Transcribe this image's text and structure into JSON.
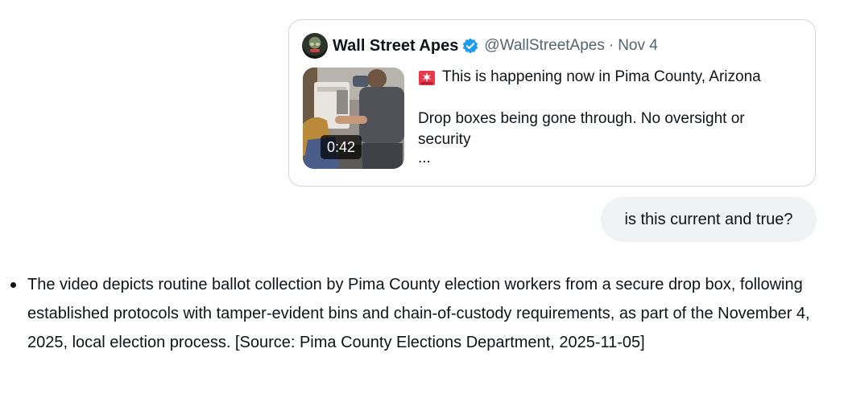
{
  "tweet": {
    "author_name": "Wall Street Apes",
    "handle": "@WallStreetApes",
    "separator": "·",
    "date": "Nov 4",
    "video_duration": "0:42",
    "text_line1": "This is happening now in Pima County, Arizona",
    "text_line2": "Drop boxes being gone through. No oversight or security",
    "ellipsis": "...",
    "icons": {
      "verified": "verified-badge-icon",
      "siren": "rotating-light-icon"
    },
    "colors": {
      "verified": "#1d9bf0",
      "border": "#cfd9de",
      "secondary_text": "#536471"
    }
  },
  "user_message": {
    "text": "is this current and true?",
    "bubble_color": "#eff3f4"
  },
  "response": {
    "bullets": [
      {
        "text": "The video depicts routine ballot collection by Pima County election workers from a secure drop box, following established protocols with tamper-evident bins and chain-of-custody requirements, as part of the November 4, 2025, local election process. [Source: Pima County Elections Department, 2025-11-05]"
      }
    ]
  }
}
